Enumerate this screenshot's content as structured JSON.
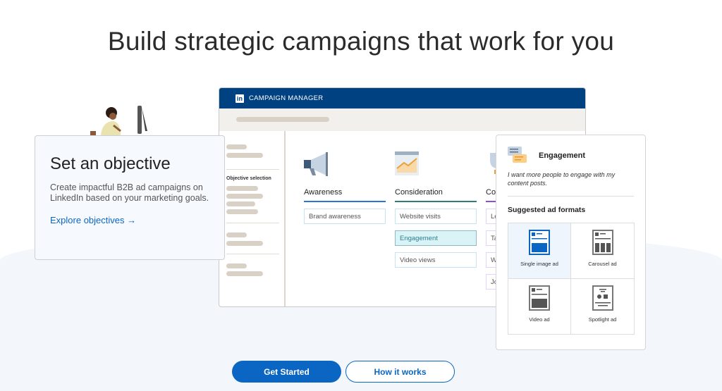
{
  "headline": "Build strategic campaigns that work for you",
  "objective_card": {
    "title": "Set an objective",
    "description": "Create impactful B2B ad campaigns on LinkedIn based on your marketing goals.",
    "link": "Explore objectives →"
  },
  "campaign_manager": {
    "logo": "in",
    "title": "CAMPAIGN MANAGER",
    "sidebar_label": "Objective selection",
    "columns": [
      {
        "title": "Awareness",
        "color": "#2b76d2",
        "options": [
          "Brand awareness"
        ]
      },
      {
        "title": "Consideration",
        "color": "#2f7d78",
        "options": [
          "Website visits",
          "Engagement",
          "Video views"
        ],
        "selected": "Engagement"
      },
      {
        "title": "Co",
        "color": "#8a4fd8",
        "options": [
          "Le",
          "Ta",
          "W",
          "Jo"
        ]
      }
    ]
  },
  "engagement_panel": {
    "title": "Engagement",
    "description": "I want more people to engage with my content posts.",
    "suggested_label": "Suggested ad formats",
    "formats": [
      "Single image ad",
      "Carousel ad",
      "Video ad",
      "Spotlight ad"
    ],
    "selected": "Single image ad"
  },
  "buttons": {
    "primary": "Get Started",
    "secondary": "How it works"
  },
  "colors": {
    "brand": "#0a66c2",
    "header": "#004182"
  }
}
